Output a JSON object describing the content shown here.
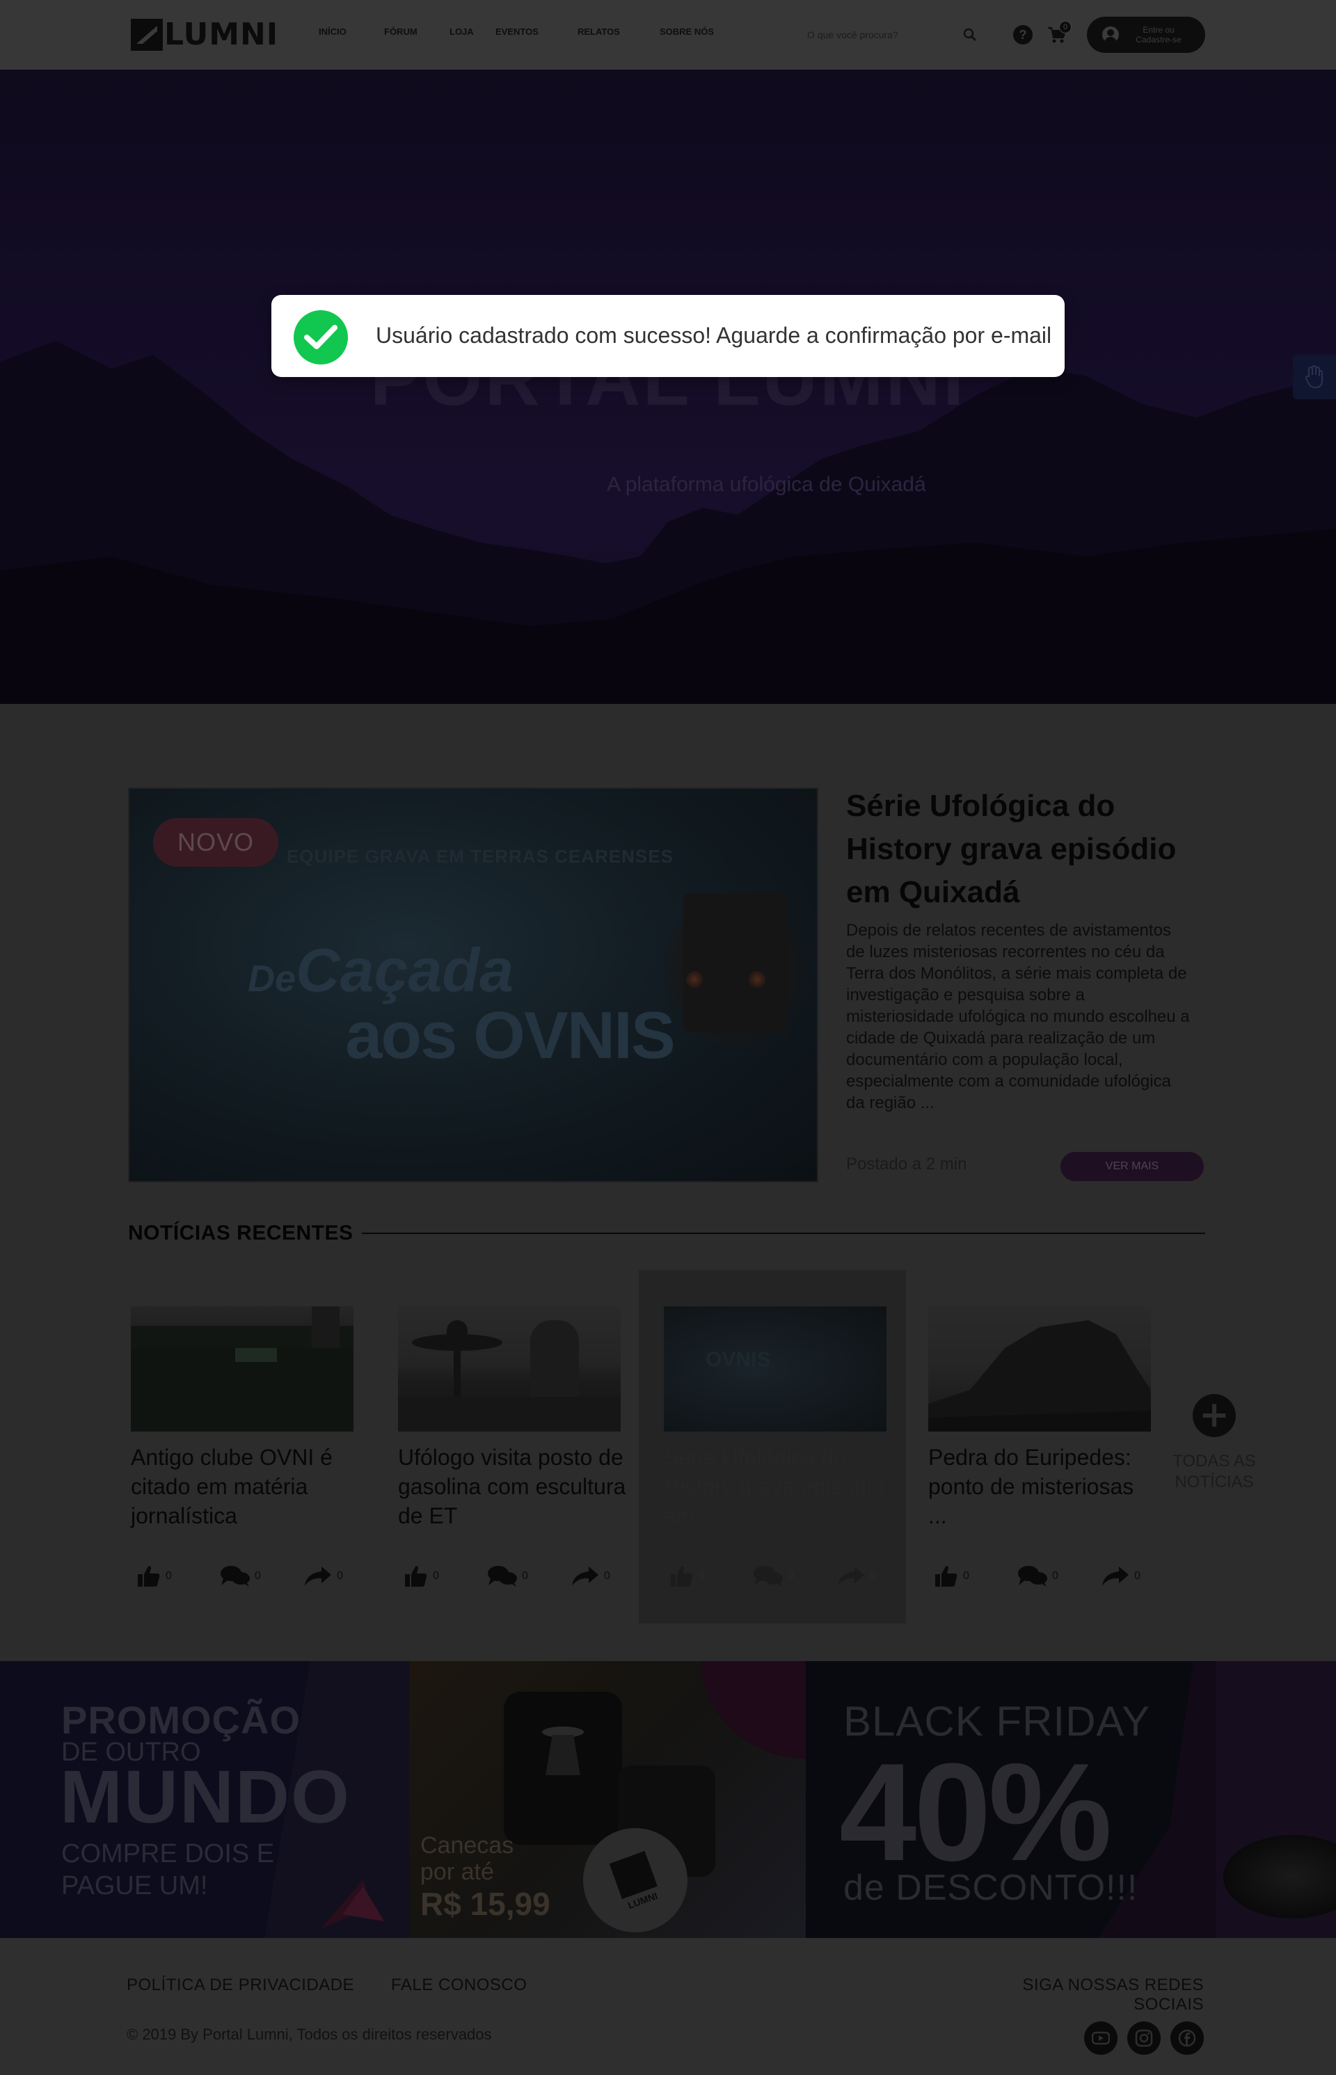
{
  "colors": {
    "toast_success": "#11c74f",
    "promo_accent": "#7a1a4a"
  },
  "header": {
    "logo_text": "LUMNI",
    "nav": [
      {
        "label": "INÍCIO"
      },
      {
        "label": "FÓRUM"
      },
      {
        "label": "LOJA"
      },
      {
        "label": "EVENTOS"
      },
      {
        "label": "RELATOS"
      },
      {
        "label": "SOBRE NÓS"
      }
    ],
    "search_placeholder": "O que você procura?",
    "cart_count": "0",
    "login_label": "Entre ou Cadastre-se"
  },
  "hero": {
    "title": "PORTAL LUMNI",
    "subtitle": "A plataforma ufológica de Quixadá"
  },
  "toast": {
    "message": "Usuário cadastrado com sucesso! Aguarde a confirmação por e-mail",
    "icon": "check-icon"
  },
  "featured": {
    "badge": "NOVO",
    "image_caption": "EQUIPE GRAVA EM TERRAS CEARENSES",
    "image_logo_1": "Caçada",
    "image_logo_2": "aos OVNIS",
    "image_logo_prefix": "De",
    "title": "Série Ufológica do History grava episódio em Quixadá",
    "text": "Depois de relatos recentes de avistamentos de luzes misteriosas recorrentes no céu da Terra dos Monólitos, a série mais completa de investigação e pesquisa sobre a misteriosidade ufológica no mundo escolheu a cidade de Quixadá para realização de um documentário com a população local, especialmente com a comunidade ufológica da região ...",
    "posted": "Postado a 2 min",
    "cta": "VER MAIS"
  },
  "recent": {
    "title": "NOTÍCIAS RECENTES",
    "cards": [
      {
        "title": "Antigo clube OVNI é citado em matéria jornalística",
        "likes": "0",
        "comments": "0",
        "shares": "0"
      },
      {
        "title": "Ufólogo visita posto de gasolina com escultura de ET",
        "likes": "0",
        "comments": "0",
        "shares": "0"
      },
      {
        "title": "Série Ufológica do History grava episódio em",
        "likes": "0",
        "comments": "0",
        "shares": "0"
      },
      {
        "title": "Pedra do Euripedes: ponto de misteriosas ...",
        "likes": "0",
        "comments": "0",
        "shares": "0"
      }
    ],
    "all_label": "TODAS AS NOTÍCIAS"
  },
  "promos": {
    "left": {
      "line1": "PROMOÇÃO",
      "line2": "DE OUTRO",
      "line3": "MUNDO",
      "line4": "COMPRE DOIS E PAGUE UM!"
    },
    "mid": {
      "line1": "Canecas\npor até",
      "price": "R$ 15,99",
      "mug_logo": "LUMNI"
    },
    "right": {
      "line1": "BLACK FRIDAY",
      "line2": "40%",
      "line3": "de DESCONTO!!!"
    }
  },
  "footer": {
    "privacy": "POLÍTICA DE PRIVACIDADE",
    "contact": "FALE CONOSCO",
    "social_label": "SIGA NOSSAS REDES SOCIAIS",
    "copyright": "© 2019 By Portal Lumni, Todos os direitos reservados",
    "social": [
      {
        "icon": "youtube-icon"
      },
      {
        "icon": "instagram-icon"
      },
      {
        "icon": "facebook-icon"
      }
    ]
  }
}
